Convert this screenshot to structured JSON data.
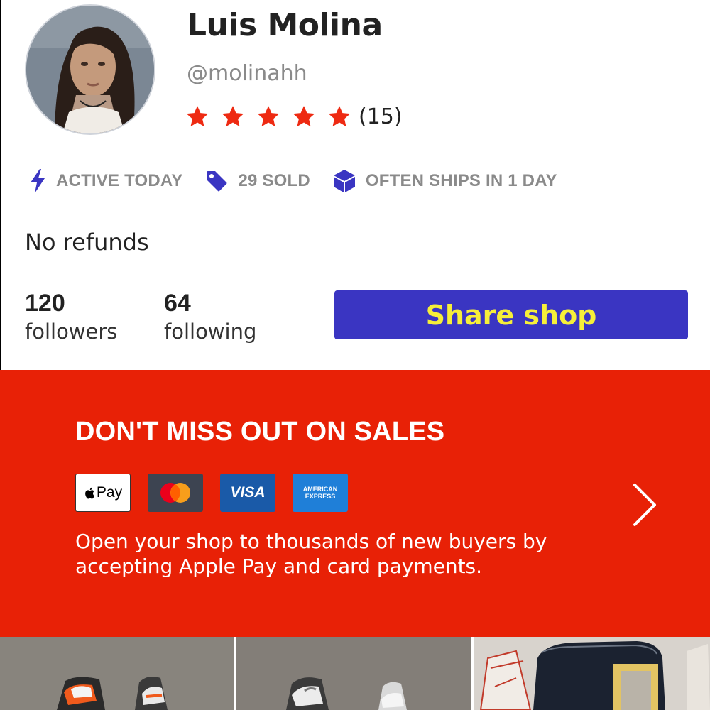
{
  "profile": {
    "name": "Luis Molina",
    "handle": "@molinahh",
    "rating": {
      "stars": 5,
      "max_stars": 5,
      "count_label": "(15)"
    },
    "stats": [
      {
        "icon": "lightning-icon",
        "label": "ACTIVE TODAY"
      },
      {
        "icon": "price-tag-icon",
        "label": "29 SOLD"
      },
      {
        "icon": "box-icon",
        "label": "OFTEN SHIPS IN 1 DAY"
      }
    ],
    "policy": "No refunds",
    "followers": {
      "count": "120",
      "label": "followers"
    },
    "following": {
      "count": "64",
      "label": "following"
    },
    "share_button": "Share shop"
  },
  "promo": {
    "title": "DON'T MISS OUT ON SALES",
    "payment_cards": [
      {
        "icon": "apple-pay-icon",
        "label": "Pay"
      },
      {
        "icon": "mastercard-icon",
        "label": ""
      },
      {
        "icon": "visa-icon",
        "label": "VISA"
      },
      {
        "icon": "amex-icon",
        "label_line1": "AMERICAN",
        "label_line2": "EXPRESS"
      }
    ],
    "body": "Open your shop to thousands of new buyers by accepting Apple Pay and card payments.",
    "chevron_icon": "chevron-right-icon"
  },
  "colors": {
    "accent_red": "#e82106",
    "star_red": "#ee2a12",
    "button_blue": "#3a35c2",
    "button_text_yellow": "#f6ef39",
    "stat_icon_blue": "#3a35c2",
    "muted_gray": "#8a8a8a"
  },
  "listings": [
    {
      "name": "listing-thumb-sneakers-orange"
    },
    {
      "name": "listing-thumb-sneakers-white"
    },
    {
      "name": "listing-thumb-bag"
    }
  ]
}
